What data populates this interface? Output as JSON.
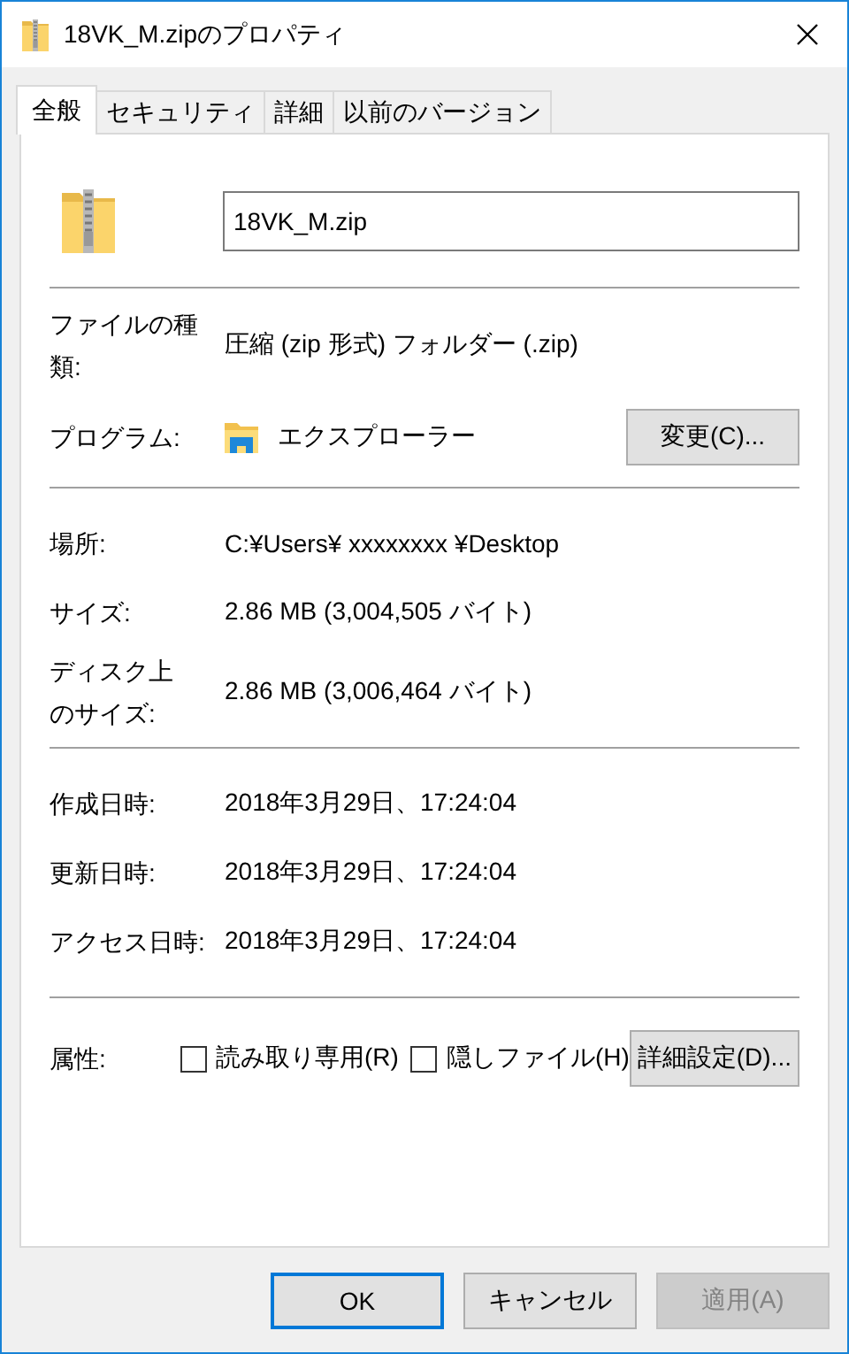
{
  "window": {
    "title": "18VK_M.zipのプロパティ"
  },
  "tabs": [
    {
      "label": "全般",
      "selected": true
    },
    {
      "label": "セキュリティ",
      "selected": false
    },
    {
      "label": "詳細",
      "selected": false
    },
    {
      "label": "以前のバージョン",
      "selected": false
    }
  ],
  "file": {
    "name": "18VK_M.zip"
  },
  "sections": [
    [
      {
        "kind": "text",
        "label": "ファイルの種類:",
        "value": "圧縮 (zip 形式) フォルダー (.zip)"
      },
      {
        "kind": "program",
        "label": "プログラム:",
        "value": "エクスプローラー",
        "button": "変更(C)..."
      }
    ],
    [
      {
        "kind": "text",
        "label": "場所:",
        "value": "C:¥Users¥ xxxxxxxx ¥Desktop"
      },
      {
        "kind": "text",
        "label": "サイズ:",
        "value": "2.86 MB (3,004,505 バイト)"
      },
      {
        "kind": "text",
        "label": "ディスク上のサイズ:",
        "value": "2.86 MB (3,006,464 バイト)"
      }
    ],
    [
      {
        "kind": "text",
        "label": "作成日時:",
        "value": "2018年3月29日、17:24:04"
      },
      {
        "kind": "text",
        "label": "更新日時:",
        "value": "2018年3月29日、17:24:04"
      },
      {
        "kind": "text",
        "label": "アクセス日時:",
        "value": "2018年3月29日、17:24:04"
      }
    ],
    [
      {
        "kind": "attributes",
        "label": "属性:",
        "checkboxes": [
          {
            "label": "読み取り専用(R)",
            "checked": false
          },
          {
            "label": "隠しファイル(H)",
            "checked": false
          }
        ],
        "button": "詳細設定(D)..."
      }
    ]
  ],
  "buttons": [
    {
      "label": "OK",
      "default": true,
      "disabled": false
    },
    {
      "label": "キャンセル",
      "default": false,
      "disabled": false
    },
    {
      "label": "適用(A)",
      "default": false,
      "disabled": true
    }
  ]
}
